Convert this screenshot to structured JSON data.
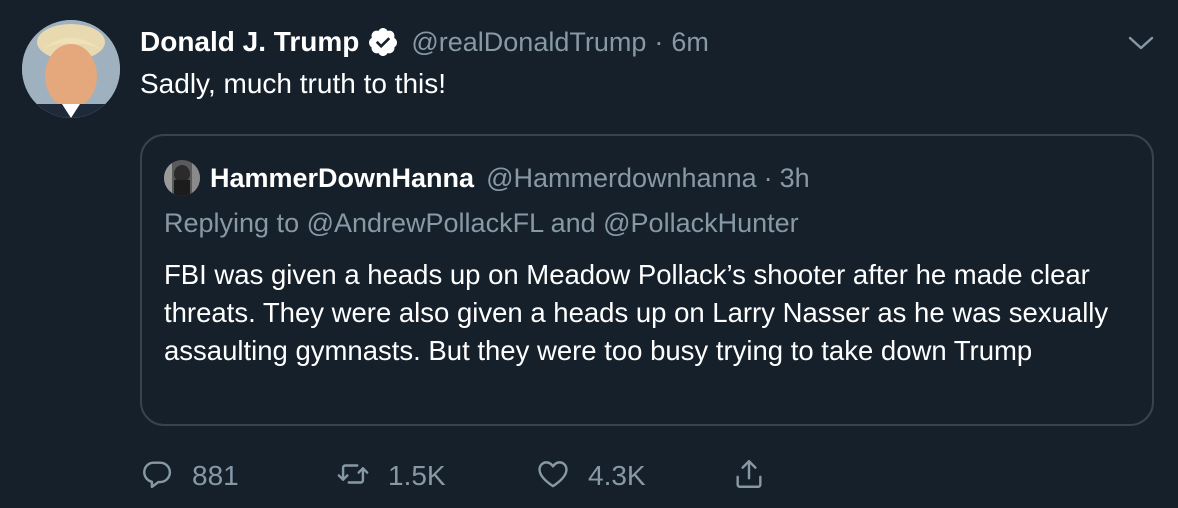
{
  "tweet": {
    "author_name": "Donald J. Trump",
    "handle": "@realDonaldTrump",
    "separator": "·",
    "time": "6m",
    "text": "Sadly, much truth to this!"
  },
  "quoted_tweet": {
    "author_name": "HammerDownHanna",
    "handle": "@Hammerdownhanna",
    "separator": "·",
    "time": "3h",
    "replying_to": "Replying to @AndrewPollackFL and @PollackHunter",
    "text": "FBI was given a heads up on Meadow Pollack’s shooter after he made clear threats. They were also given a heads up on Larry Nasser as he was sexually assaulting gymnasts. But they were too busy trying to take down Trump"
  },
  "actions": {
    "replies": "881",
    "retweets": "1.5K",
    "likes": "4.3K"
  },
  "icons": [
    "verified-badge-icon",
    "chevron-down-icon",
    "reply-icon",
    "retweet-icon",
    "like-icon",
    "share-icon"
  ],
  "colors": {
    "background": "#15202b",
    "text": "#ffffff",
    "secondary_text": "#8899a6",
    "border": "#38444d"
  }
}
